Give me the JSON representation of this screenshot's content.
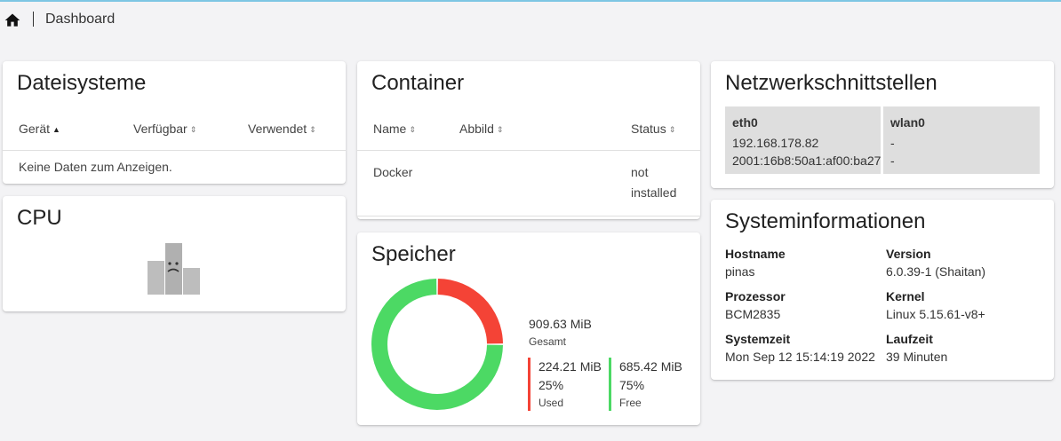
{
  "breadcrumb": {
    "current": "Dashboard"
  },
  "filesystems": {
    "title": "Dateisysteme",
    "columns": [
      "Gerät",
      "Verfügbar",
      "Verwendet"
    ],
    "empty_text": "Keine Daten zum Anzeigen."
  },
  "cpu": {
    "title": "CPU"
  },
  "containers": {
    "title": "Container",
    "columns": [
      "Name",
      "Abbild",
      "Status"
    ],
    "rows": [
      {
        "name": "Docker",
        "image": "",
        "status_line1": "not",
        "status_line2": "installed"
      }
    ]
  },
  "memory": {
    "title": "Speicher",
    "total": "909.63 MiB",
    "total_label": "Gesamt",
    "used": {
      "value": "224.21 MiB",
      "percent": "25%",
      "label": "Used",
      "fraction": 0.25,
      "color": "#f44336"
    },
    "free": {
      "value": "685.42 MiB",
      "percent": "75%",
      "label": "Free",
      "fraction": 0.75,
      "color": "#4cd964"
    }
  },
  "network": {
    "title": "Netzwerkschnittstellen",
    "interfaces": [
      {
        "name": "eth0",
        "ipv4": "192.168.178.82",
        "ipv6": "2001:16b8:50a1:af00:ba27"
      },
      {
        "name": "wlan0",
        "ipv4": "-",
        "ipv6": "-"
      }
    ]
  },
  "sysinfo": {
    "title": "Systeminformationen",
    "hostname_label": "Hostname",
    "hostname": "pinas",
    "version_label": "Version",
    "version": "6.0.39-1 (Shaitan)",
    "processor_label": "Prozessor",
    "processor": "BCM2835",
    "kernel_label": "Kernel",
    "kernel": "Linux 5.15.61-v8+",
    "time_label": "Systemzeit",
    "time": "Mon Sep 12 15:14:19 2022",
    "uptime_label": "Laufzeit",
    "uptime": "39 Minuten"
  },
  "colors": {
    "accent": "#7dc6e3",
    "used": "#f44336",
    "free": "#4cd964",
    "card": "#ffffff",
    "background": "#f3f3f5"
  }
}
